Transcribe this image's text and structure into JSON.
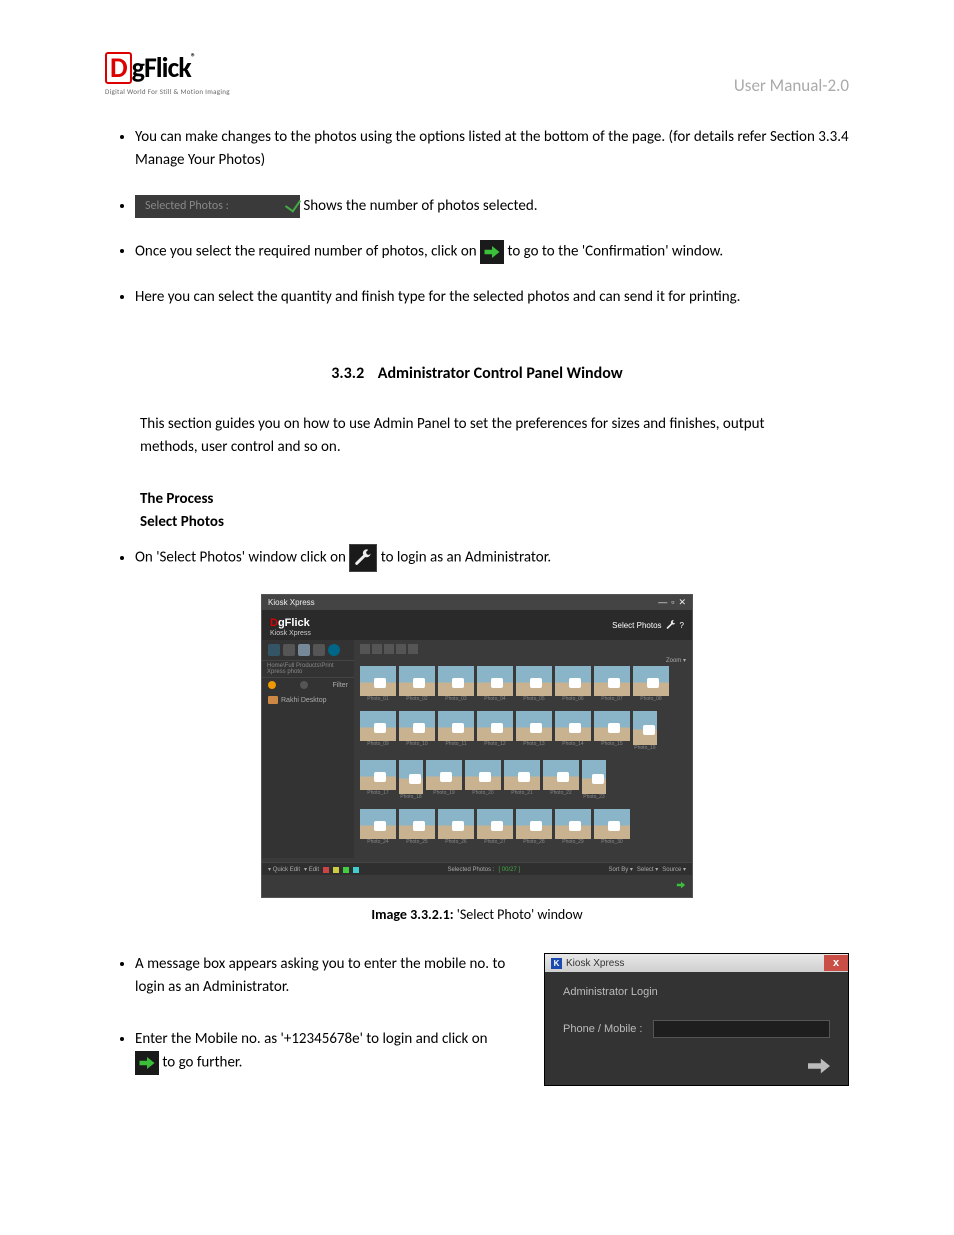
{
  "header": {
    "logo_d": "D",
    "logo_g": "g",
    "logo_rest": "Flick",
    "logo_reg": "®",
    "logo_tagline": "Digital World For Still & Motion Imaging",
    "manual": "User Manual-2.0"
  },
  "bullets_top": {
    "b1": "You can make changes to the photos using the options listed at the bottom of the page. (for details refer Section 3.3.4 Manage Your Photos)",
    "b2_label": "Selected Photos :",
    "b2_after": " Shows the number of photos selected.",
    "b3_before": "Once you select the required number of photos, click on ",
    "b3_after": " to go to the 'Confirmation' window.",
    "b4": "Here you can select the quantity and finish type for the selected photos and can send it for printing."
  },
  "section": {
    "number": "3.3.2",
    "title": "Administrator Control Panel Window",
    "intro": "This section guides you on how to use Admin Panel to set the preferences for sizes and finishes, output methods, user control and so on.",
    "sub1": "The Process",
    "sub2": "Select Photos",
    "b5_before": "On 'Select Photos' window click on ",
    "b5_after": " to login as an Administrator."
  },
  "screenshot1": {
    "window_title": "Kiosk Xpress",
    "brand_sub": "Kiosk Xpress",
    "select_photos": "Select Photos",
    "help": "?",
    "breadcrumb": "Home\\Full Products\\Print Xpress photo",
    "filter_label": "Filter",
    "node_desktop": "Rakhi Desktop",
    "zoom": "Zoom",
    "thumb_prefix": "Photo_",
    "bottom_quicktools": "Quick Edit",
    "bottom_edit": "Edit",
    "bottom_selected": "Selected Photos :",
    "bottom_count": "[ 00/27 ]",
    "bottom_sortby": "Sort By",
    "bottom_select": "Select",
    "bottom_source": "Source"
  },
  "caption1": {
    "bold": "Image 3.3.2.1:",
    "text": " 'Select Photo' window"
  },
  "bullets_bottom": {
    "b6": "A message box appears asking you to enter the mobile no. to login as an Administrator.",
    "b7_before": "Enter the Mobile no. as '+12345678e' to login and click on ",
    "b7_after": " to go further."
  },
  "login_dialog": {
    "title": "Kiosk Xpress",
    "heading": "Administrator Login",
    "field_label": "Phone / Mobile :",
    "close": "x"
  }
}
